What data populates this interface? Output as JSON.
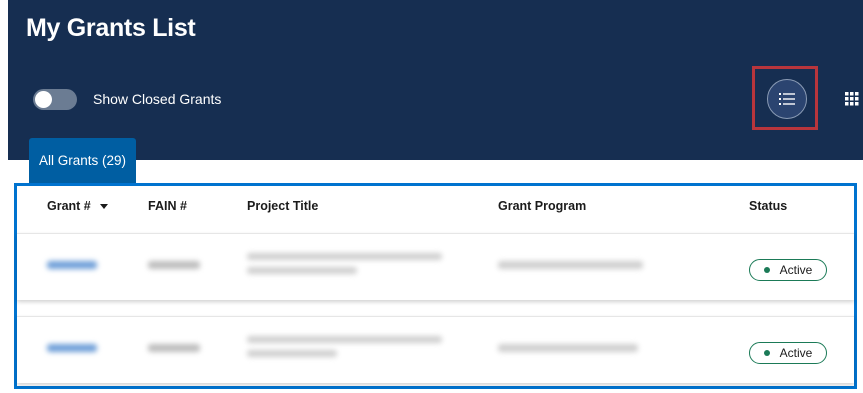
{
  "header": {
    "title": "My Grants List",
    "toggle_label": "Show Closed Grants",
    "toggle_on": false
  },
  "view_buttons": {
    "list_icon": "list-view-icon",
    "grid_icon": "grid-view-icon"
  },
  "tabs": [
    {
      "label": "All Grants (29)"
    }
  ],
  "table": {
    "columns": [
      "Grant #",
      "FAIN #",
      "Project Title",
      "Grant Program",
      "Status"
    ],
    "sort_icon": "caret-down-icon",
    "rows": [
      {
        "status": "Active"
      },
      {
        "status": "Active"
      }
    ]
  },
  "colors": {
    "header_bg": "#162e51",
    "tab_bg": "#005ea2",
    "table_border": "#0073cf",
    "highlight_border": "#b8353c",
    "status_green": "#1b7a57"
  }
}
